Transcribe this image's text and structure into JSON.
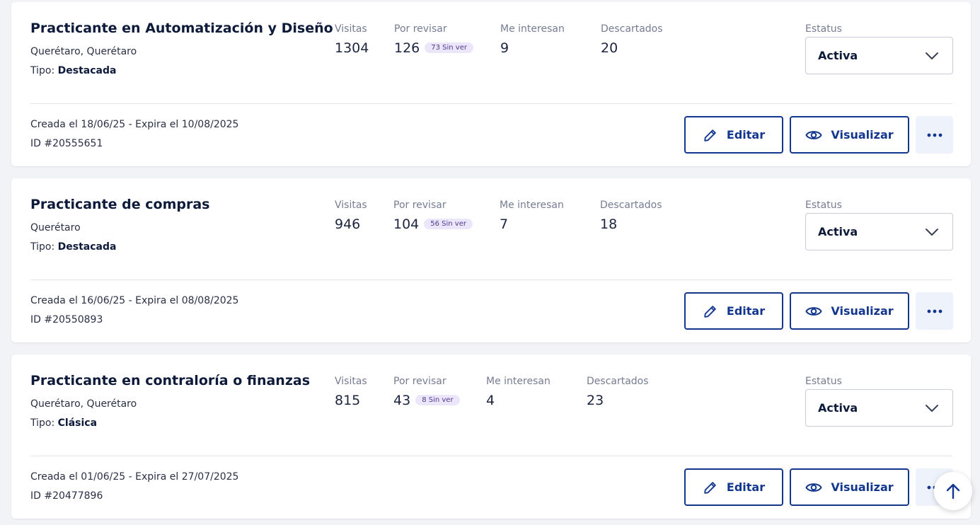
{
  "jobs": [
    {
      "title": "Practicante en Automatización y Diseño",
      "location": "Querétaro, Querétaro",
      "tipo_label": "Tipo:",
      "tipo": "Destacada",
      "stats": {
        "visitas_label": "Visitas",
        "visitas": "1304",
        "revisar_label": "Por revisar",
        "revisar": "126",
        "sin_ver": "73 Sin ver",
        "interesan_label": "Me interesan",
        "interesan": "9",
        "descartados_label": "Descartados",
        "descartados": "20"
      },
      "estatus_label": "Estatus",
      "estatus": "Activa",
      "dates": "Creada el 18/06/25 - Expira el 10/08/2025",
      "id": "ID #20555651",
      "edit_label": "Editar",
      "view_label": "Visualizar"
    },
    {
      "title": "Practicante de compras",
      "location": "Querétaro",
      "tipo_label": "Tipo:",
      "tipo": "Destacada",
      "stats": {
        "visitas_label": "Visitas",
        "visitas": "946",
        "revisar_label": "Por revisar",
        "revisar": "104",
        "sin_ver": "56 Sin ver",
        "interesan_label": "Me interesan",
        "interesan": "7",
        "descartados_label": "Descartados",
        "descartados": "18"
      },
      "estatus_label": "Estatus",
      "estatus": "Activa",
      "dates": "Creada el 16/06/25 - Expira el 08/08/2025",
      "id": "ID #20550893",
      "edit_label": "Editar",
      "view_label": "Visualizar"
    },
    {
      "title": "Practicante en contraloría o finanzas",
      "location": "Querétaro, Querétaro",
      "tipo_label": "Tipo:",
      "tipo": "Clásica",
      "stats": {
        "visitas_label": "Visitas",
        "visitas": "815",
        "revisar_label": "Por revisar",
        "revisar": "43",
        "sin_ver": "8 Sin ver",
        "interesan_label": "Me interesan",
        "interesan": "4",
        "descartados_label": "Descartados",
        "descartados": "23"
      },
      "estatus_label": "Estatus",
      "estatus": "Activa",
      "dates": "Creada el 01/06/25 - Expira el 27/07/2025",
      "id": "ID #20477896",
      "edit_label": "Editar",
      "view_label": "Visualizar"
    }
  ],
  "icons": {
    "edit": "pencil-icon",
    "view": "eye-icon",
    "more": "more-dots-icon",
    "dropdown": "chevron-down-icon",
    "scroll_top": "arrow-up-icon"
  },
  "colors": {
    "primary": "#13378f",
    "badge_bg": "#ece6fb",
    "background": "#f2f3f7"
  }
}
